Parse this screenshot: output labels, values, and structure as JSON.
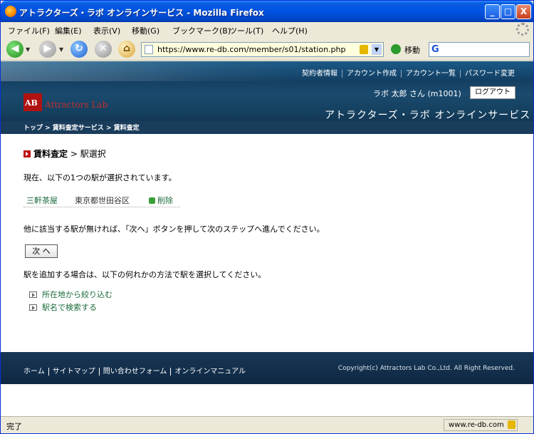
{
  "window": {
    "title": "アトラクターズ・ラボ オンラインサービス - Mozilla Firefox",
    "min_label": "_",
    "max_label": "□",
    "close_label": "X"
  },
  "menu": {
    "items": [
      "ファイル(F)",
      "編集(E)",
      "表示(V)",
      "移動(G)",
      "ブックマーク(B)",
      "ツール(T)",
      "ヘルプ(H)"
    ]
  },
  "nav": {
    "url": "https://www.re-db.com/member/s01/station.php",
    "go_label": "移動",
    "search_icon_glyph": "G"
  },
  "site": {
    "top_links": [
      "契約者情報",
      "アカウント作成",
      "アカウント一覧",
      "パスワード変更"
    ],
    "logo_text": "Attractors Lab",
    "user_name": "ラボ 太郎 さん (m1001)",
    "logout_label": "ログアウト",
    "service_title": "アトラクターズ・ラボ オンラインサービス",
    "breadcrumb": "トップ > 賃料査定サービス > 賃料査定"
  },
  "main": {
    "heading_bold": "賃料査定",
    "heading_rest": " > 駅選択",
    "selected_msg": "現在、以下の1つの駅が選択されています。",
    "station": {
      "name": "三軒茶屋",
      "area": "東京都世田谷区",
      "delete_label": "削除"
    },
    "next_msg": "他に該当する駅が無ければ、「次へ」ボタンを押して次のステップへ進んでください。",
    "next_button": "次 へ",
    "add_msg": "駅を追加する場合は、以下の何れかの方法で駅を選択してください。",
    "links": [
      "所在地から絞り込む",
      "駅名で検索する"
    ]
  },
  "footer": {
    "links": [
      "ホーム",
      "サイトマップ",
      "問い合わせフォーム",
      "オンラインマニュアル"
    ],
    "copyright": "Copyright(c) Attractors Lab Co.,Ltd. All Right Reserved."
  },
  "status": {
    "text": "完了",
    "domain": "www.re-db.com"
  },
  "colors": {
    "titlebar": "#0053e1",
    "header_bg": "#1a4a6e",
    "accent_red": "#c01010",
    "link_green": "#1a6a3a"
  }
}
